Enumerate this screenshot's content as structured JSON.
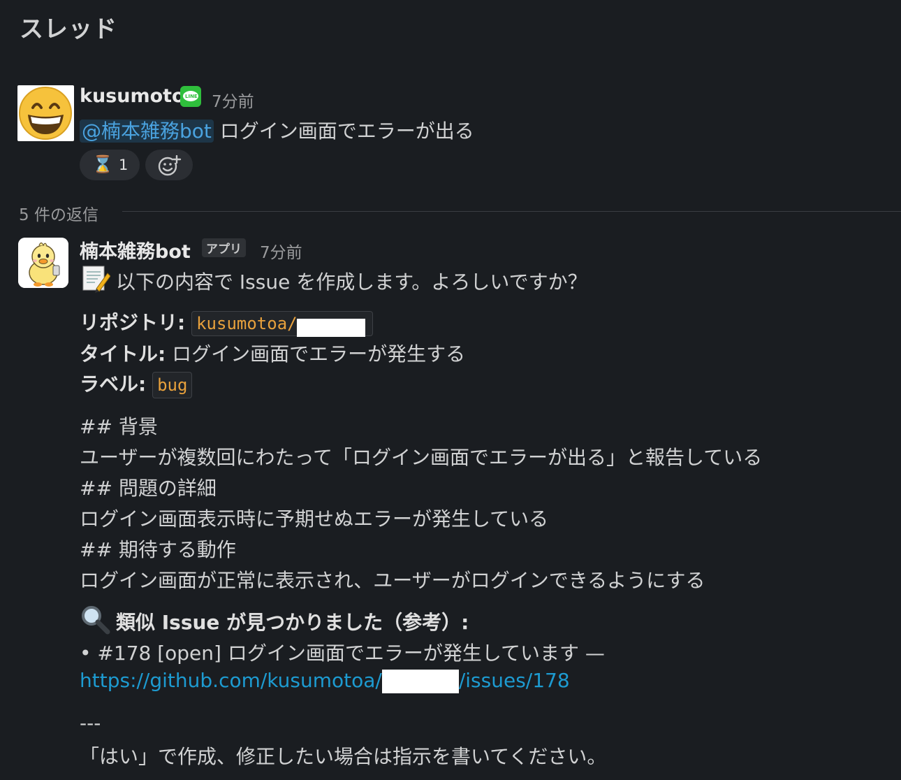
{
  "header": {
    "title": "スレッド"
  },
  "parent": {
    "author": "kusumoto",
    "badge_icon": "line-icon",
    "badge_text": "LINE",
    "time": "7分前",
    "mention": "@楠本雑務bot",
    "text": " ログイン画面でエラーが出る",
    "reactions": [
      {
        "icon": "hourglass-icon",
        "emoji": "⌛",
        "count": "1"
      },
      {
        "icon": "add-reaction-icon"
      }
    ]
  },
  "replies": {
    "label": "5 件の返信"
  },
  "reply": {
    "author": "楠本雑務bot",
    "app_badge": "アプリ",
    "time": "7分前",
    "intro": "以下の内容で Issue を作成します。よろしいですか？",
    "repo_label": "リポジトリ:",
    "repo_value": "kusumotoa/",
    "title_label": "タイトル:",
    "title_value": " ログイン画面でエラーが発生する",
    "label_label": "ラベル:",
    "label_value": "bug",
    "body": [
      "## 背景",
      "ユーザーが複数回にわたって「ログイン画面でエラーが出る」と報告している",
      "## 問題の詳細",
      "ログイン画面表示時に予期せぬエラーが発生している",
      "## 期待する動作",
      "ログイン画面が正常に表示され、ユーザーがログインできるようにする"
    ],
    "similar_heading": "類似 Issue が見つかりました（参考）:",
    "similar_item": "• #178 [open] ログイン画面でエラーが発生しています —",
    "link_prefix": "https://github.com/kusumotoa/",
    "link_suffix": "/issues/178",
    "separator": "---",
    "footer": "「はい」で作成、修正したい場合は指示を書いてください。"
  }
}
